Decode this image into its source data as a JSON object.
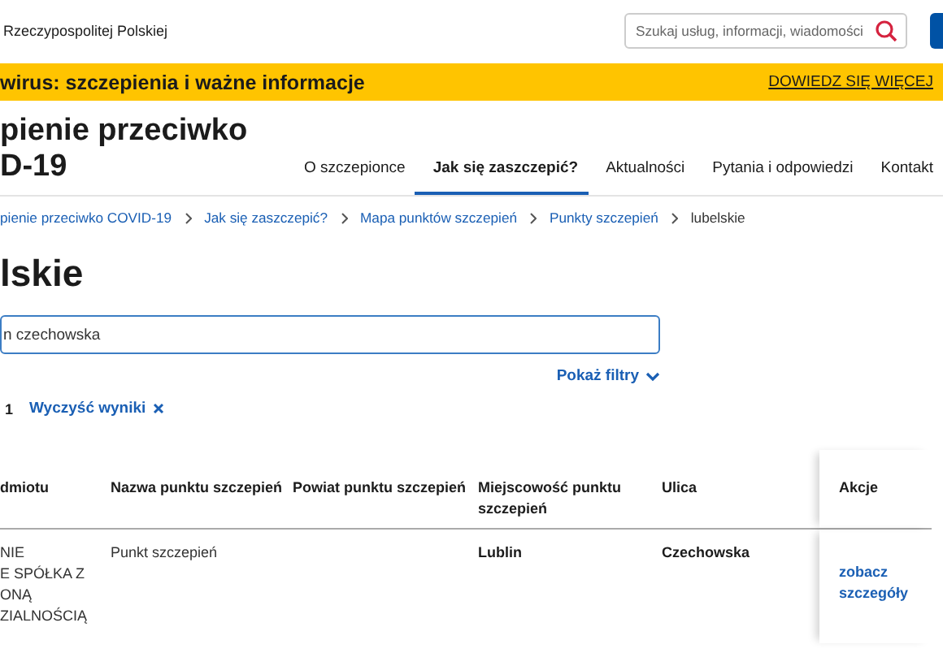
{
  "header": {
    "site_name": "Rzeczypospolitej Polskiej",
    "search": {
      "placeholder": "Szukaj usług, informacji, wiadomości"
    }
  },
  "banner": {
    "text": "wirus: szczepienia i ważne informacje",
    "link": "DOWIEDZ SIĘ WIĘCEJ"
  },
  "site_title": [
    "pienie przeciwko",
    "D-19"
  ],
  "nav": [
    {
      "label": "O szczepionce",
      "selected": false
    },
    {
      "label": "Jak się zaszczepić?",
      "selected": true
    },
    {
      "label": "Aktualności",
      "selected": false
    },
    {
      "label": "Pytania i odpowiedzi",
      "selected": false
    },
    {
      "label": "Kontakt",
      "selected": false
    }
  ],
  "breadcrumbs": [
    {
      "label": "pienie przeciwko COVID-19",
      "current": false
    },
    {
      "label": "Jak się zaszczepić?",
      "current": false
    },
    {
      "label": "Mapa punktów szczepień",
      "current": false
    },
    {
      "label": "Punkty szczepień",
      "current": false
    },
    {
      "label": "lubelskie",
      "current": true
    }
  ],
  "page_title": "lskie",
  "search_field": {
    "value": "n czechowska"
  },
  "show_filters": "Pokaż filtry",
  "results": {
    "count": "1",
    "clear": "Wyczyść wyniki"
  },
  "table": {
    "columns": [
      "dmiotu",
      "Nazwa punktu szczepień",
      "Powiat punktu szczepień",
      "Miejscowość punktu szczepień",
      "Ulica",
      "Akcje"
    ],
    "rows": [
      {
        "entity": [
          "NIE",
          "E SPÓŁKA Z",
          "ONĄ",
          "ZIALNOŚCIĄ"
        ],
        "point_name": "Punkt szczepień",
        "city": "Lublin",
        "street": "Czechowska",
        "action": "zobacz szczegóły"
      }
    ]
  }
}
